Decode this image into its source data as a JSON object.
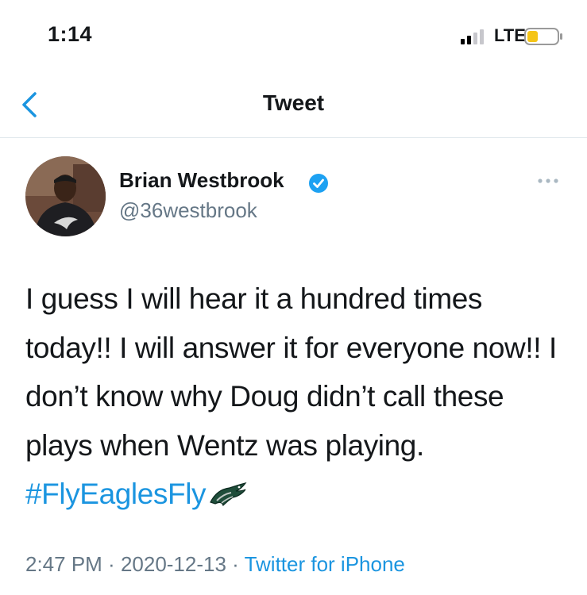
{
  "status_bar": {
    "time": "1:14",
    "network": "LTE"
  },
  "nav": {
    "title": "Tweet"
  },
  "tweet": {
    "author_name": "Brian Westbrook",
    "handle": "@36westbrook",
    "verified": true,
    "text": "I guess I will hear it a hundred times today!! I will answer it for everyone now!! I don’t know why Doug didn’t call these plays when Wentz was playing. ",
    "hashtag": "#FlyEaglesFly",
    "time": "2:47 PM",
    "separator1": " · ",
    "date": "2020-12-13",
    "separator2": " · ",
    "source": "Twitter for iPhone"
  },
  "colors": {
    "accent": "#1b95e0",
    "secondary_text": "#657786",
    "battery_low": "#f5c518"
  },
  "icons": [
    "back-chevron-icon",
    "verified-badge-icon",
    "more-dots-icon",
    "eagles-logo-icon",
    "signal-icon",
    "battery-icon"
  ]
}
